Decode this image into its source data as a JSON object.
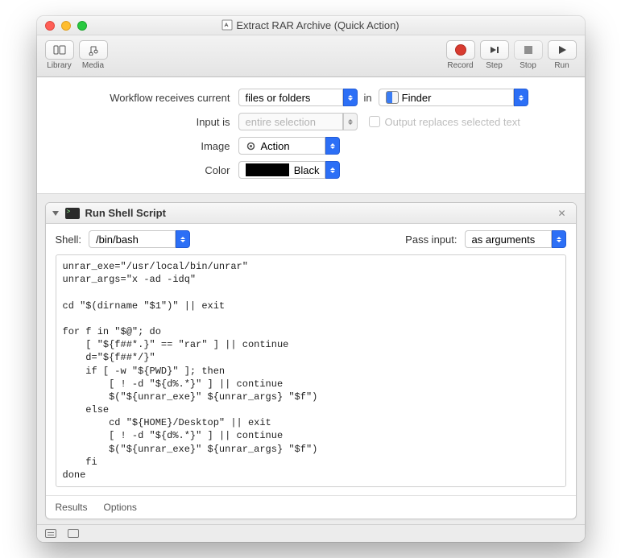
{
  "window": {
    "title": "Extract RAR Archive (Quick Action)"
  },
  "toolbar": {
    "library": "Library",
    "media": "Media",
    "record": "Record",
    "step": "Step",
    "stop": "Stop",
    "run": "Run"
  },
  "config": {
    "receives_label": "Workflow receives current",
    "receives_value": "files or folders",
    "in_label": "in",
    "app_value": "Finder",
    "input_is_label": "Input is",
    "input_is_value": "entire selection",
    "output_replaces_label": "Output replaces selected text",
    "image_label": "Image",
    "image_value": "Action",
    "color_label": "Color",
    "color_value": "Black"
  },
  "action": {
    "title": "Run Shell Script",
    "shell_label": "Shell:",
    "shell_value": "/bin/bash",
    "pass_input_label": "Pass input:",
    "pass_input_value": "as arguments",
    "footer_results": "Results",
    "footer_options": "Options",
    "script": "unrar_exe=\"/usr/local/bin/unrar\"\nunrar_args=\"x -ad -idq\"\n\ncd \"$(dirname \"$1\")\" || exit\n\nfor f in \"$@\"; do\n    [ \"${f##*.}\" == \"rar\" ] || continue\n    d=\"${f##*/}\"\n    if [ -w \"${PWD}\" ]; then\n        [ ! -d \"${d%.*}\" ] || continue\n        $(\"${unrar_exe}\" ${unrar_args} \"$f\")\n    else\n        cd \"${HOME}/Desktop\" || exit\n        [ ! -d \"${d%.*}\" ] || continue\n        $(\"${unrar_exe}\" ${unrar_args} \"$f\")\n    fi\ndone"
  }
}
